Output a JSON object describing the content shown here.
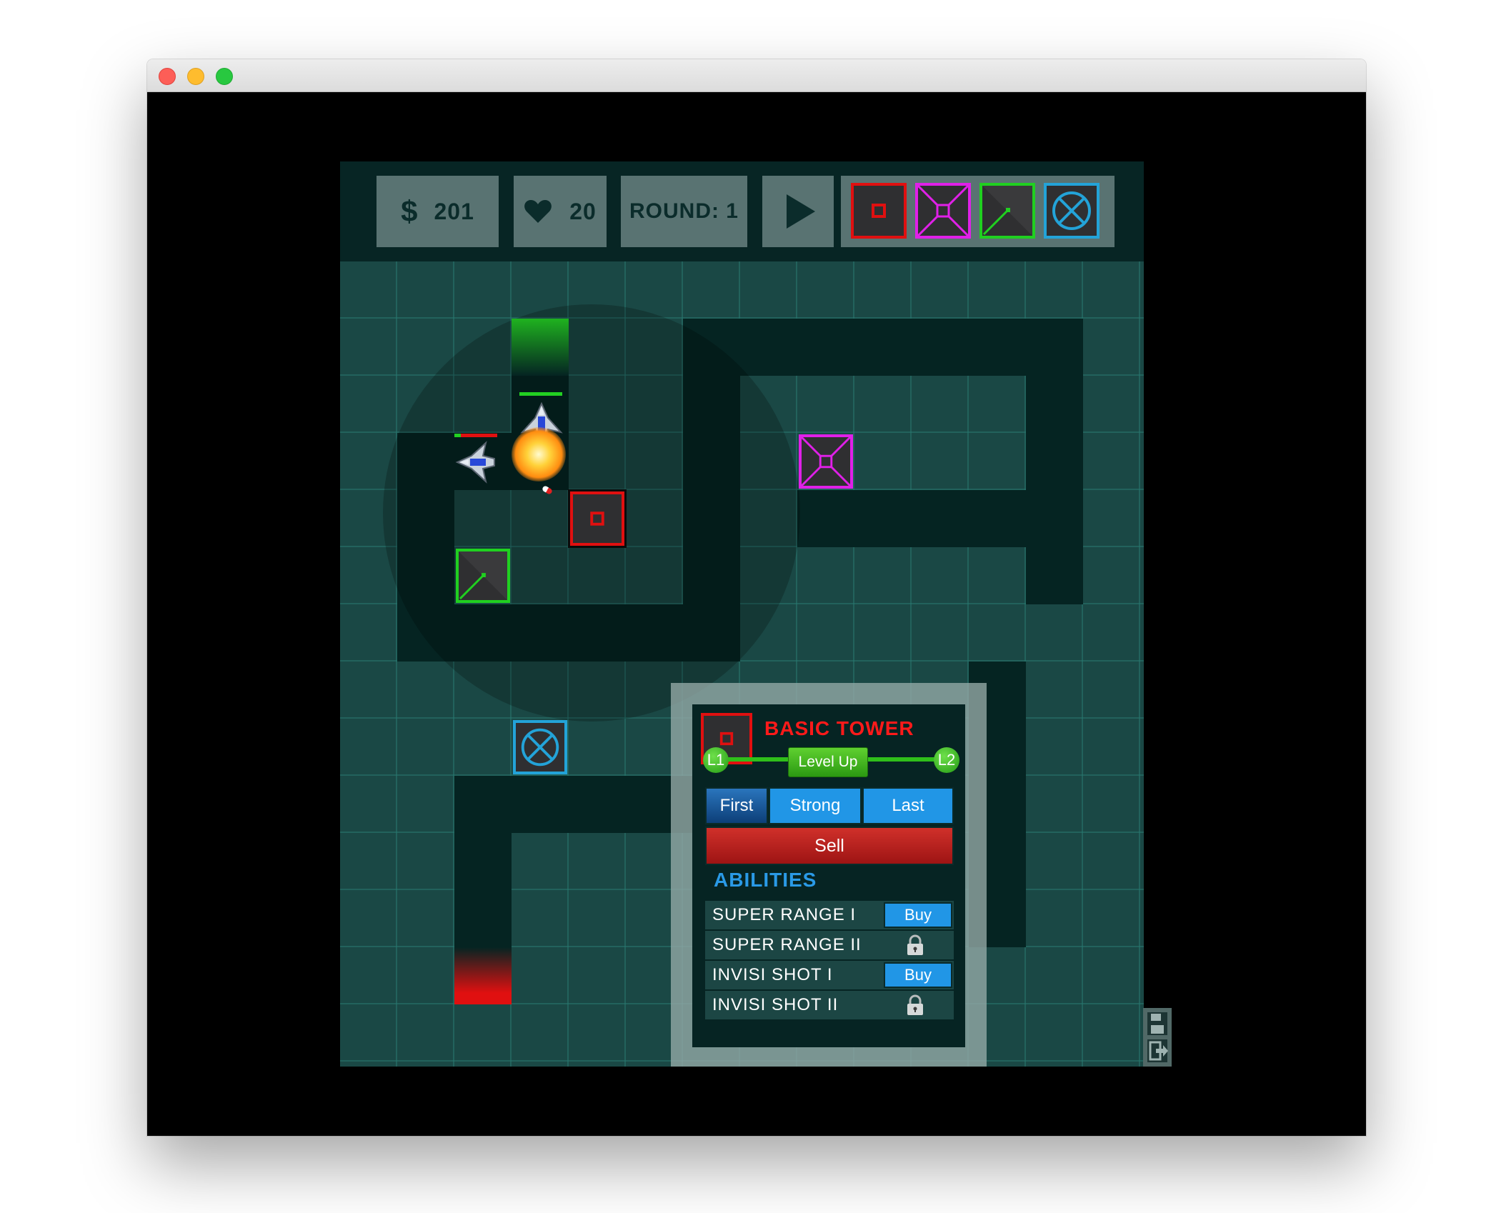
{
  "hud": {
    "money_icon": "dollar-icon",
    "money": "201",
    "lives_icon": "heart-icon",
    "lives": "20",
    "round_label": "ROUND: 1",
    "play_icon": "play-icon"
  },
  "shop": {
    "towers": [
      {
        "name": "basic-tower",
        "color": "#e01010"
      },
      {
        "name": "multi-tower",
        "color": "#e020e8"
      },
      {
        "name": "sniper-tower",
        "color": "#20d020"
      },
      {
        "name": "freeze-tower",
        "color": "#23a3d8"
      }
    ]
  },
  "panel": {
    "title": "BASIC TOWER",
    "level_current": "L1",
    "level_next": "L2",
    "level_up_label": "Level Up",
    "targeting": [
      {
        "label": "First",
        "selected": true
      },
      {
        "label": "Strong",
        "selected": false
      },
      {
        "label": "Last",
        "selected": false
      }
    ],
    "sell_label": "Sell",
    "abilities_title": "ABILITIES",
    "abilities": [
      {
        "name": "SUPER RANGE I",
        "action": "Buy",
        "locked": false
      },
      {
        "name": "SUPER RANGE II",
        "action": "",
        "locked": true
      },
      {
        "name": "INVISI SHOT I",
        "action": "Buy",
        "locked": false
      },
      {
        "name": "INVISI SHOT II",
        "action": "",
        "locked": true
      }
    ]
  },
  "colors": {
    "accent_red": "#ff1a1a",
    "accent_blue": "#2196e6",
    "accent_green": "#2fbf1a",
    "board": "#1a4845",
    "path": "#052422"
  }
}
